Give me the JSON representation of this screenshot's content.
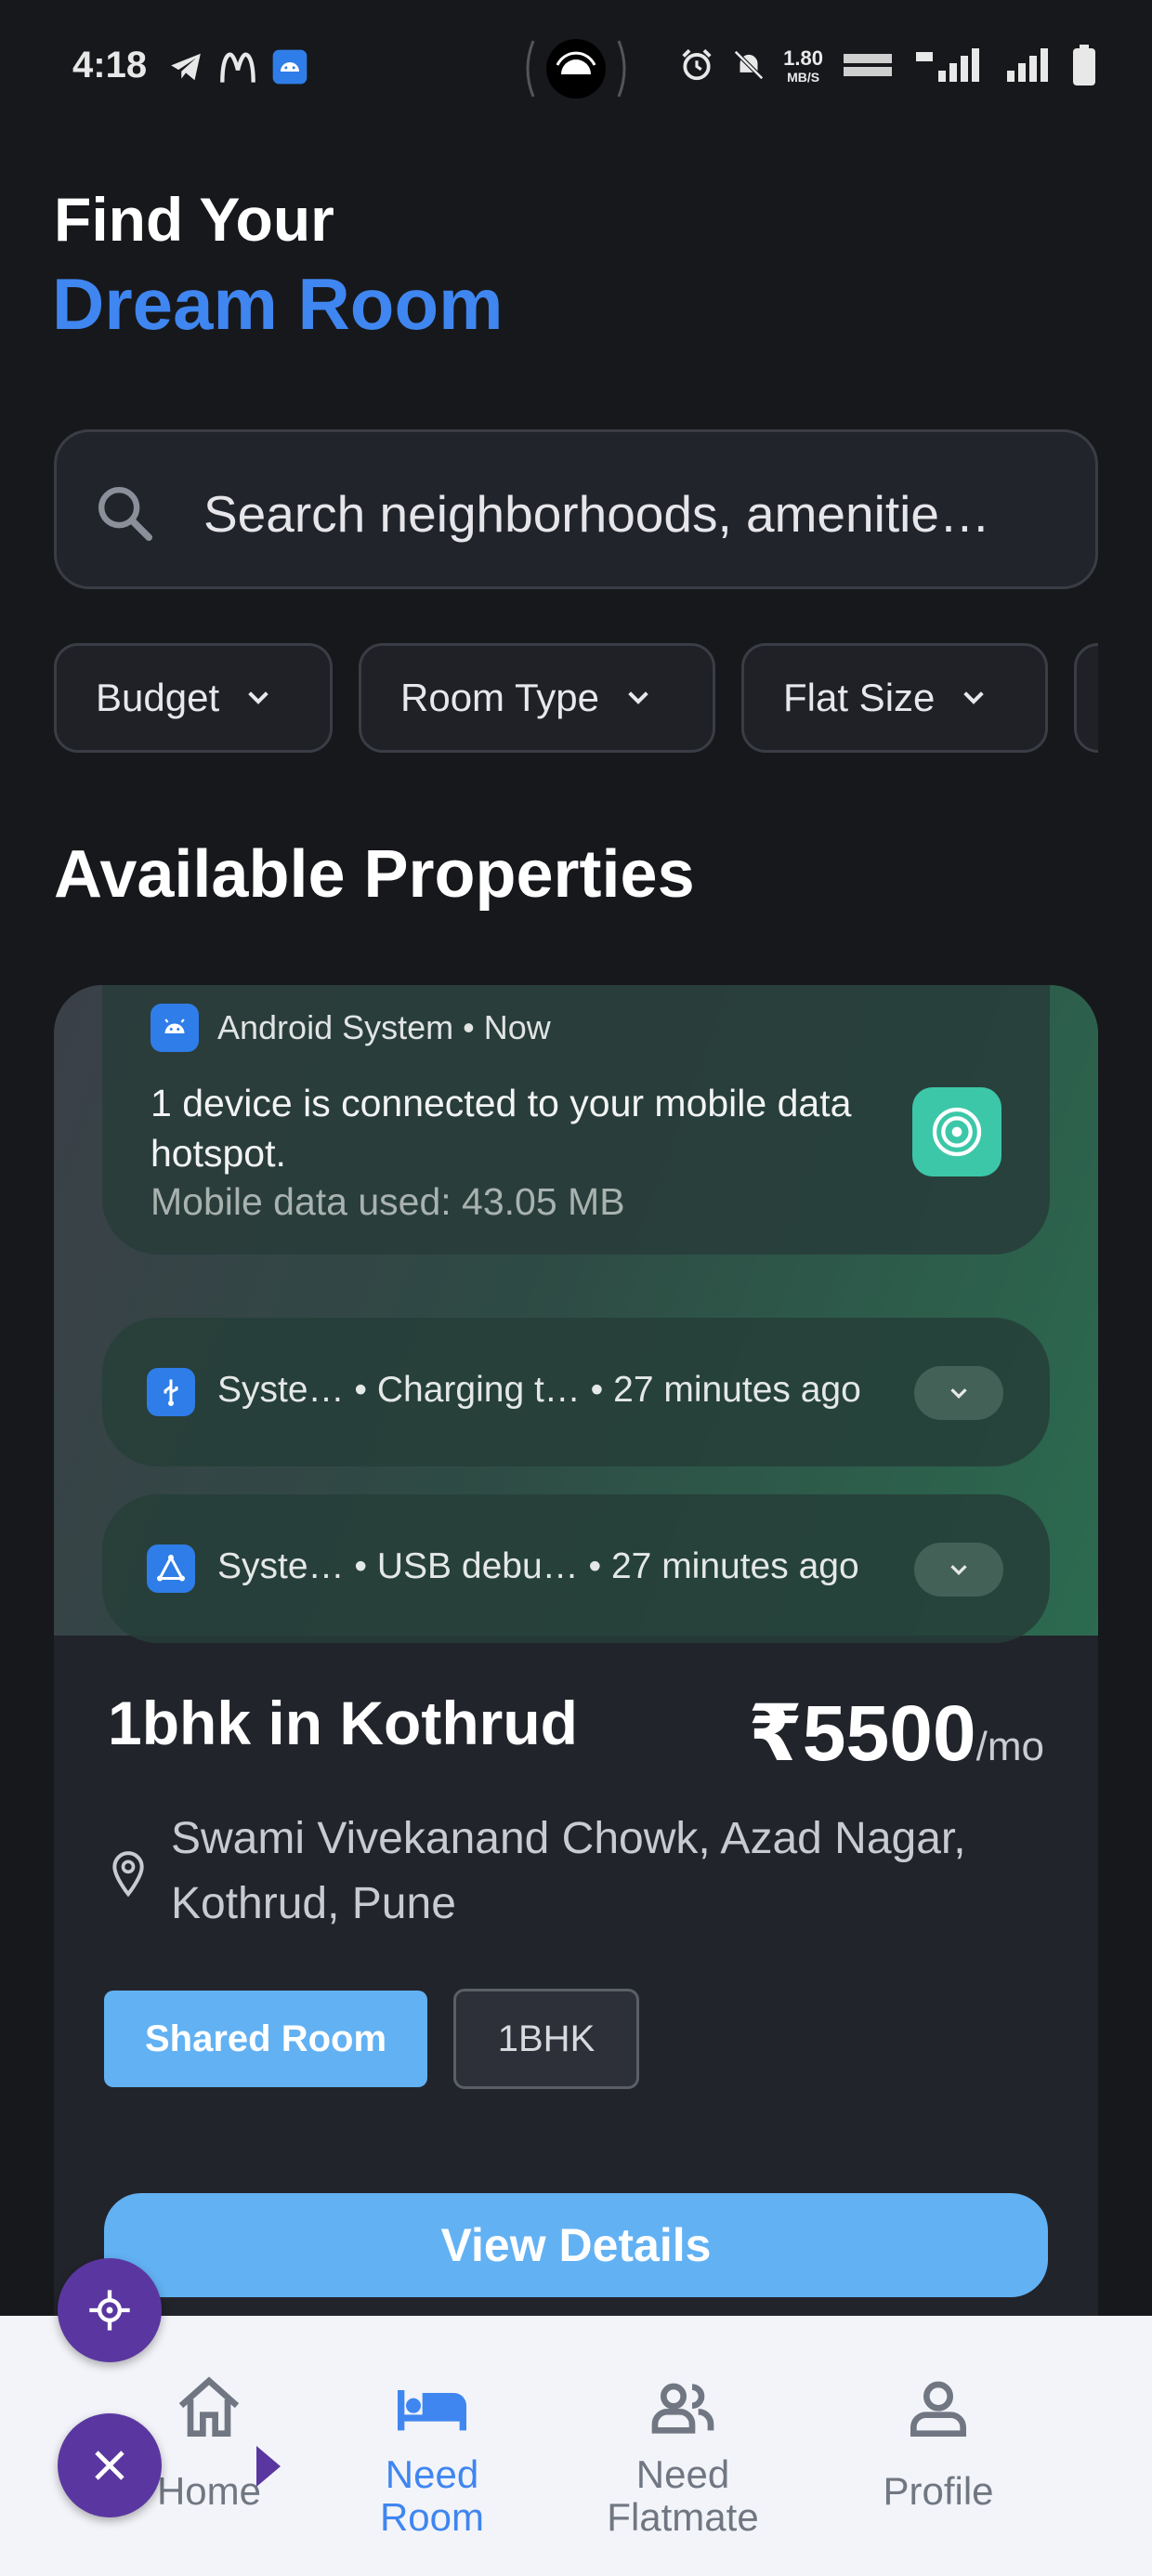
{
  "status_bar": {
    "time": "4:18",
    "speed_value": "1.80",
    "speed_unit": "MB/S"
  },
  "header": {
    "title_line1": "Find Your",
    "title_line2": "Dream Room"
  },
  "search": {
    "placeholder": "Search neighborhoods, amenitie…"
  },
  "filters": [
    {
      "label": "Budget"
    },
    {
      "label": "Room Type"
    },
    {
      "label": "Flat Size"
    }
  ],
  "section_title": "Available Properties",
  "notification_overlay": {
    "app_line": "Android System • Now",
    "body": "1 device is connected to your mobile data hotspot.",
    "sub": "Mobile data used: 43.05 MB",
    "row1": "Syste…   • Charging t… • 27 minutes ago",
    "row2": "Syste…   • USB debu… • 27 minutes ago"
  },
  "property": {
    "title": "1bhk in Kothrud",
    "price": "₹5500",
    "price_unit": "/mo",
    "address": "Swami Vivekanand Chowk, Azad Nagar, Kothrud, Pune",
    "tags": [
      "Shared Room",
      "1BHK"
    ],
    "cta": "View Details"
  },
  "bottom_nav": [
    {
      "label": "Home",
      "icon": "home-icon",
      "active": false
    },
    {
      "label": "Need Room",
      "icon": "bed-icon",
      "active": true
    },
    {
      "label": "Need Flatmate",
      "icon": "people-icon",
      "active": false
    },
    {
      "label": "Profile",
      "icon": "person-icon",
      "active": false
    }
  ],
  "colors": {
    "background": "#17181c",
    "accent_blue": "#3f86f0",
    "button_blue": "#62b1f3",
    "fab_purple": "#5a37a0",
    "nav_background": "#f3f4f9"
  }
}
